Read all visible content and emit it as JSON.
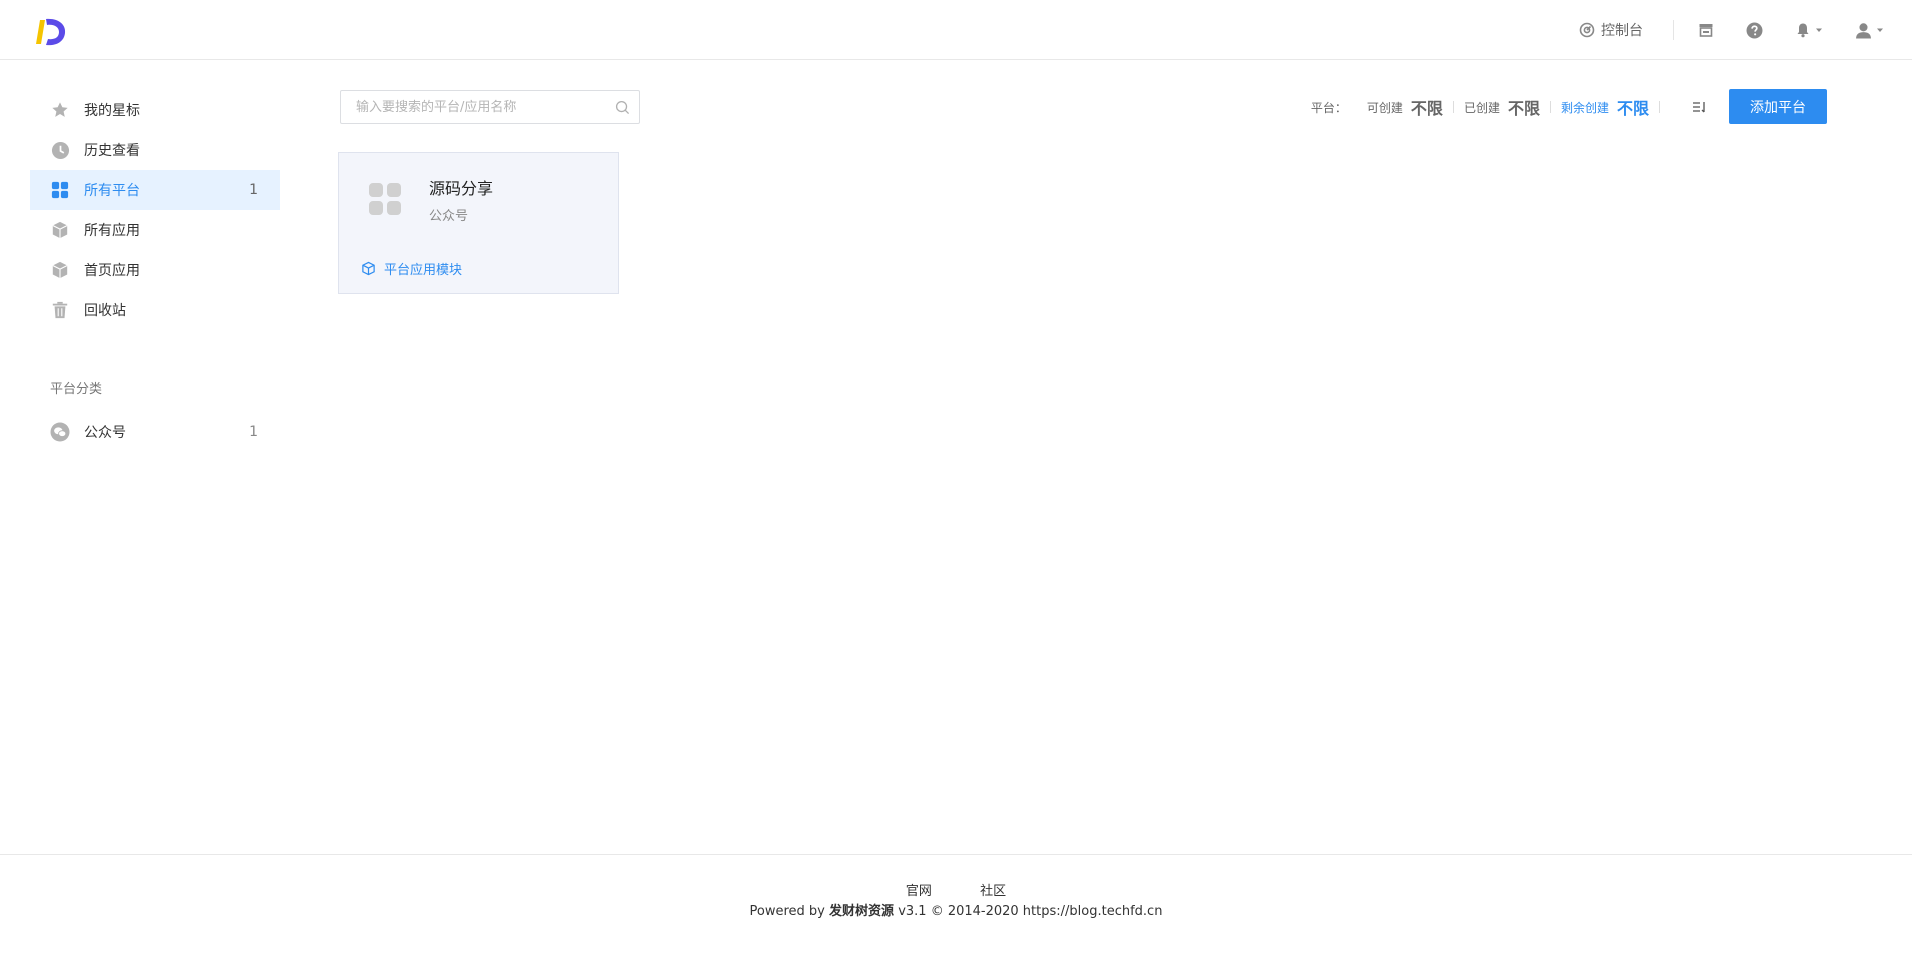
{
  "header": {
    "logo_icon": "brand-logo",
    "console_label": "控制台",
    "icons": [
      "store-icon",
      "help-icon",
      "bell-icon",
      "user-icon"
    ]
  },
  "sidebar": {
    "items": [
      {
        "label": "我的星标",
        "icon": "star-icon",
        "count": ""
      },
      {
        "label": "历史查看",
        "icon": "clock-icon",
        "count": ""
      },
      {
        "label": "所有平台",
        "icon": "grid-icon",
        "count": "1"
      },
      {
        "label": "所有应用",
        "icon": "cube-icon",
        "count": ""
      },
      {
        "label": "首页应用",
        "icon": "cube-icon",
        "count": ""
      },
      {
        "label": "回收站",
        "icon": "trash-icon",
        "count": ""
      }
    ],
    "category_title": "平台分类",
    "categories": [
      {
        "label": "公众号",
        "icon": "wechat-icon",
        "count": "1"
      }
    ]
  },
  "toolbar": {
    "search_placeholder": "输入要搜索的平台/应用名称",
    "platform_label": "平台：",
    "can_create_label": "可创建",
    "can_create_value": "不限",
    "created_label": "已创建",
    "created_value": "不限",
    "remaining_label": "剩余创建",
    "remaining_value": "不限",
    "add_button": "添加平台"
  },
  "cards": [
    {
      "title": "源码分享",
      "subtitle": "公众号",
      "link": "平台应用模块"
    }
  ],
  "footer": {
    "links": [
      "官网",
      "社区"
    ],
    "powered_prefix": "Powered by",
    "brand": "发财树资源",
    "copy_suffix": "v3.1 © 2014-2020 https://blog.techfd.cn"
  },
  "colors": {
    "accent": "#2d8cf0",
    "active_bg": "#e6f2ff",
    "card_bg": "#f3f5fb"
  }
}
